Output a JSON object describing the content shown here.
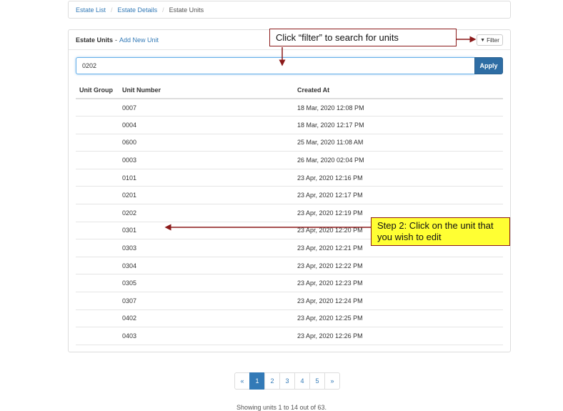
{
  "breadcrumb": {
    "items": [
      "Estate List",
      "Estate Details"
    ],
    "separator": "/",
    "current": "Estate Units"
  },
  "panel": {
    "title": "Estate Units",
    "separator": "-",
    "add_link": "Add New Unit",
    "filter_icon": "filter-icon",
    "filter_label": "Filter"
  },
  "search": {
    "value": "0202",
    "apply_label": "Apply"
  },
  "table": {
    "headers": [
      "Unit Group",
      "Unit Number",
      "Created At"
    ],
    "rows": [
      {
        "group": "",
        "unit": "0007",
        "created": "18 Mar, 2020 12:08 PM"
      },
      {
        "group": "",
        "unit": "0004",
        "created": "18 Mar, 2020 12:17 PM"
      },
      {
        "group": "",
        "unit": "0600",
        "created": "25 Mar, 2020 11:08 AM"
      },
      {
        "group": "",
        "unit": "0003",
        "created": "26 Mar, 2020 02:04 PM"
      },
      {
        "group": "",
        "unit": "0101",
        "created": "23 Apr, 2020 12:16 PM"
      },
      {
        "group": "",
        "unit": "0201",
        "created": "23 Apr, 2020 12:17 PM"
      },
      {
        "group": "",
        "unit": "0202",
        "created": "23 Apr, 2020 12:19 PM"
      },
      {
        "group": "",
        "unit": "0301",
        "created": "23 Apr, 2020 12:20 PM"
      },
      {
        "group": "",
        "unit": "0303",
        "created": "23 Apr, 2020 12:21 PM"
      },
      {
        "group": "",
        "unit": "0304",
        "created": "23 Apr, 2020 12:22 PM"
      },
      {
        "group": "",
        "unit": "0305",
        "created": "23 Apr, 2020 12:23 PM"
      },
      {
        "group": "",
        "unit": "0307",
        "created": "23 Apr, 2020 12:24 PM"
      },
      {
        "group": "",
        "unit": "0402",
        "created": "23 Apr, 2020 12:25 PM"
      },
      {
        "group": "",
        "unit": "0403",
        "created": "23 Apr, 2020 12:26 PM"
      }
    ]
  },
  "pagination": {
    "prev": "«",
    "pages": [
      "1",
      "2",
      "3",
      "4",
      "5"
    ],
    "active_page": "1",
    "next": "»"
  },
  "footer": {
    "showing_text": "Showing units 1 to 14 out of 63."
  },
  "annotations": {
    "filter_callout": "Click “filter” to search for units",
    "step2_callout": "Step 2: Click on the unit that you wish to edit",
    "callout_border_color": "#8b1a1a",
    "step2_bg_color": "#ffff33"
  },
  "colors": {
    "link": "#337ab7",
    "primary_button": "#2e6da4"
  }
}
